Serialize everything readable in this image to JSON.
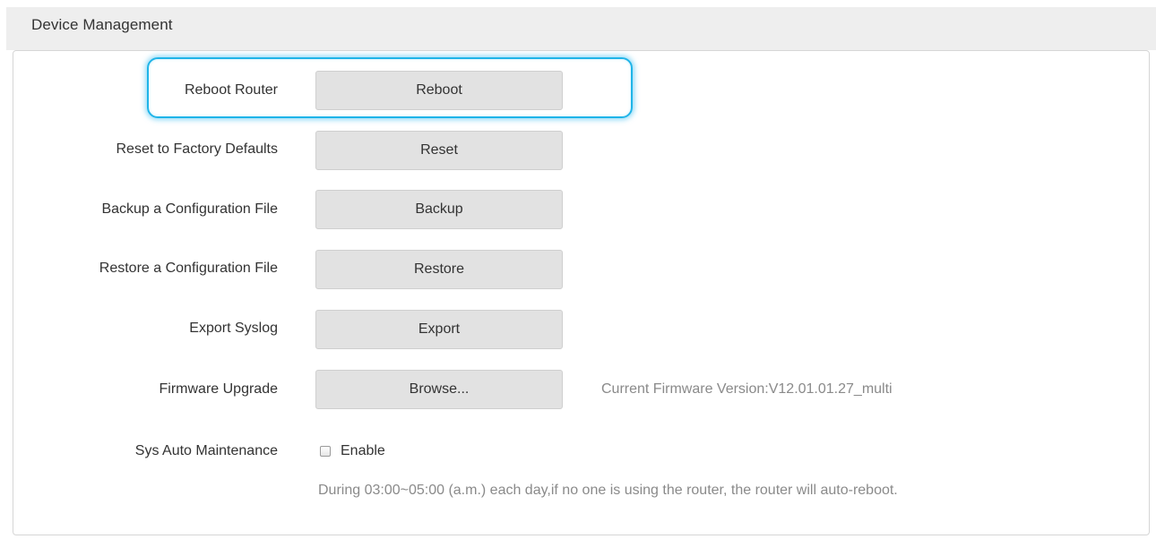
{
  "section": {
    "title": "Device Management"
  },
  "rows": {
    "reboot": {
      "label": "Reboot Router",
      "button": "Reboot"
    },
    "reset": {
      "label": "Reset to Factory Defaults",
      "button": "Reset"
    },
    "backup": {
      "label": "Backup a Configuration File",
      "button": "Backup"
    },
    "restore": {
      "label": "Restore a Configuration File",
      "button": "Restore"
    },
    "syslog": {
      "label": "Export Syslog",
      "button": "Export"
    },
    "firmware": {
      "label": "Firmware Upgrade",
      "button": "Browse...",
      "version_text": "Current Firmware Version:V12.01.01.27_multi"
    },
    "maintenance": {
      "label": "Sys Auto Maintenance",
      "checkbox_label": "Enable",
      "checked": false,
      "note": "During 03:00~05:00 (a.m.) each day,if no one is using the router, the router will auto-reboot."
    }
  },
  "colors": {
    "highlight": "#1fb4e8",
    "button_bg": "#e2e2e2",
    "header_bg": "#eeeeee",
    "muted_text": "#8a8a8a"
  }
}
